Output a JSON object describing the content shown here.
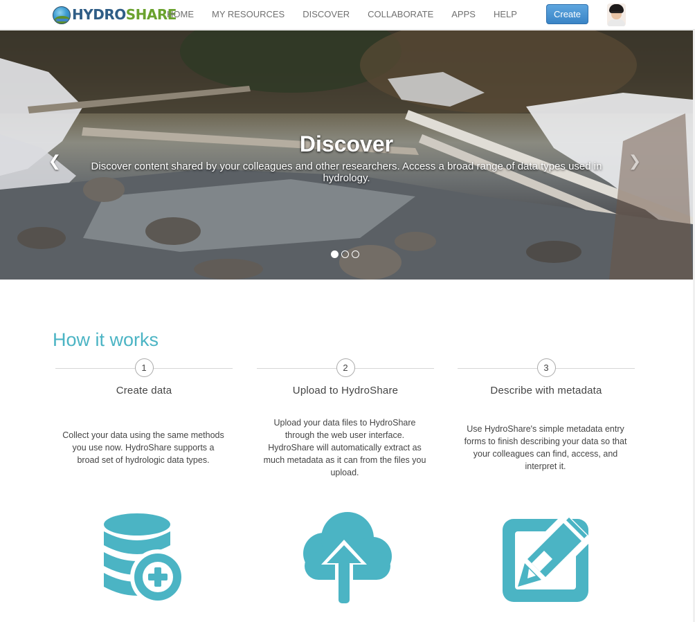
{
  "header": {
    "logo_part1": "HYDRO",
    "logo_part2": "SHARE",
    "nav": [
      "HOME",
      "MY RESOURCES",
      "DISCOVER",
      "COLLABORATE",
      "APPS",
      "HELP"
    ],
    "create_label": "Create"
  },
  "hero": {
    "title": "Discover",
    "text": "Discover content shared by your colleagues and other researchers. Access a broad range of data types used in hydrology.",
    "prev_glyph": "❮",
    "next_glyph": "❯",
    "slide_count": 3,
    "active_slide": 1
  },
  "how": {
    "title": "How it works",
    "steps": [
      {
        "number": "1",
        "title": "Create data",
        "desc": "Collect your data using the same methods you use now. HydroShare supports a broad set of hydrologic data types.",
        "icon": "database-plus-icon"
      },
      {
        "number": "2",
        "title": "Upload to HydroShare",
        "desc": "Upload your data files to HydroShare through the web user interface. HydroShare will automatically extract as much metadata as it can from the files you upload.",
        "icon": "cloud-upload-icon"
      },
      {
        "number": "3",
        "title": "Describe with metadata",
        "desc": "Use HydroShare's simple metadata entry forms to finish describing your data so that your colleagues can find, access, and interpret it.",
        "icon": "edit-square-icon"
      }
    ]
  },
  "colors": {
    "accent": "#4bb4c4",
    "create_button": "#3a84c6",
    "logo_hydro": "#2f5d86",
    "logo_share": "#6aa22e"
  }
}
